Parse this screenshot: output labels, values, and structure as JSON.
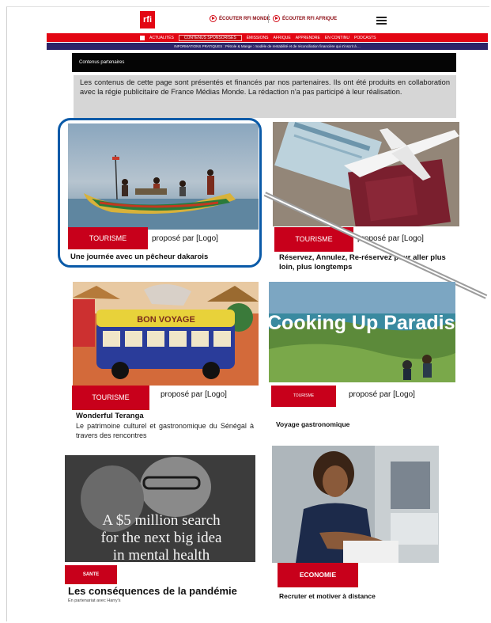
{
  "header": {
    "logo_text": "rfi",
    "live1": "ÉCOUTER RFI MONDE",
    "live2": "ÉCOUTER RFI AFRIQUE"
  },
  "nav": {
    "items": [
      "ACTUALITÉS",
      "CONTENUS SPONSORISÉS",
      "ÉMISSIONS",
      "AFRIQUE",
      "APPRENDRE",
      "EN CONTINU",
      "PODCASTS"
    ],
    "ticker": "INFORMATIONS PRATIQUES : Pétrole & Mange : modèle de rentabilité et de réconciliation financière qui s'inscrit à ..."
  },
  "section": {
    "header": "Contenus partenaires",
    "disclaimer": "Les contenus de cette page sont présentés et financés par nos partenaires. Ils ont été produits en collaboration avec la régie publicitaire de France Médias Monde. La rédaction n'a pas participé à leur réalisation."
  },
  "cards": [
    {
      "badge": "TOURISME",
      "partner": "proposé par [Logo]",
      "title": "Une journée avec un pêcheur dakarois"
    },
    {
      "badge": "TOURISME",
      "partner": "proposé par [Logo]",
      "title": "Réservez, Annulez, Re-réservez pour aller plus loin, plus longtemps"
    },
    {
      "badge": "TOURISME",
      "partner": "proposé par [Logo]",
      "title": "Wonderful Teranga",
      "description": "Le patrimoine culturel et gastronomique du Sénégal à travers des rencontres",
      "image_text": "BON VOYAGE"
    },
    {
      "badge": "TOURISME",
      "partner": "proposé par [Logo]",
      "title": "Voyage gastronomique",
      "image_text": "Cooking Up Paradis"
    },
    {
      "badge": "SANTE",
      "title": "Les conséquences de la pandémie",
      "partner_small": "En partenariat avec Harry's",
      "image_text_lines": [
        "A $5 million search",
        "for the next big idea",
        "in mental health"
      ]
    },
    {
      "badge": "ECONOMIE",
      "title": "Recruter et motiver à distance"
    }
  ],
  "colors": {
    "accent": "#e30613",
    "badge": "#c8001b",
    "nav_dark": "#2c2468",
    "highlight": "#0a5aa8"
  }
}
